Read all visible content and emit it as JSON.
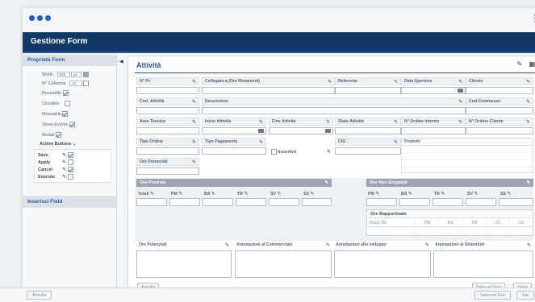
{
  "app": {
    "title": "Gestione Form"
  },
  "sidebar": {
    "heading": "Proprietà Form",
    "width": {
      "label": "Width",
      "value": "800",
      "unit": "px"
    },
    "columns": {
      "label": "N° Columns",
      "value": "12"
    },
    "props": [
      {
        "label": "Resizable",
        "checked": true
      },
      {
        "label": "Closable",
        "checked": false
      },
      {
        "label": "Moveable",
        "checked": true
      },
      {
        "label": "Show Events",
        "checked": true
      },
      {
        "label": "Modal",
        "checked": true
      }
    ],
    "actions_title": "Action Buttons",
    "actions": [
      {
        "label": "Save",
        "checked": true
      },
      {
        "label": "Apply",
        "checked": false
      },
      {
        "label": "Cancel",
        "checked": true
      },
      {
        "label": "Execute",
        "checked": false
      }
    ],
    "insert_heading": "Inserisci Field"
  },
  "main": {
    "title": "Attività",
    "row1": [
      "N° Pr.",
      "Collegata a (Ore Rimanenti)",
      "Referente",
      "Data Apertura",
      "Cliente"
    ],
    "row2": [
      "Cod. Attività",
      "Descrizione",
      "Cod.Commesse"
    ],
    "row3": [
      "Area Tecnica",
      "Inizio Attività",
      "Fine Attività",
      "Stato Attività",
      "N° Ordine Interno",
      "N° Ordine Cliente"
    ],
    "row4": [
      "Tipo Ordine",
      "Tipo Pagamento",
      "Incentivo",
      "CIG",
      "Prodotti"
    ],
    "row5": [
      "Ore Potenziali"
    ],
    "ore_previste": {
      "title": "Ore Previste",
      "cols": [
        "Totali",
        "PM",
        "BA",
        "TR",
        "SV",
        "SS"
      ]
    },
    "ore_non_erogabili": {
      "title": "Ore Non Erogabili",
      "cols": [
        "PM",
        "BA",
        "TR",
        "SV",
        "SS"
      ]
    },
    "ore_rapportinate": {
      "title": "Ore Rapportinate",
      "cols": [
        "Rapp.Tot",
        "PM",
        "BA",
        "TR",
        "SV",
        "SS"
      ]
    },
    "notes": [
      "Ore Potenziali",
      "Annotazioni al Commerciale",
      "Annotazioni allo sviluppo",
      "Annotazioni al Sistemisti"
    ],
    "buttons": {
      "cancel": "Annulla",
      "save_exit": "Salva ed Esci",
      "save": "Salva"
    }
  },
  "footer": {
    "cancel": "Annulla",
    "save_exit": "Salva ed Esci",
    "save": "Sal"
  }
}
